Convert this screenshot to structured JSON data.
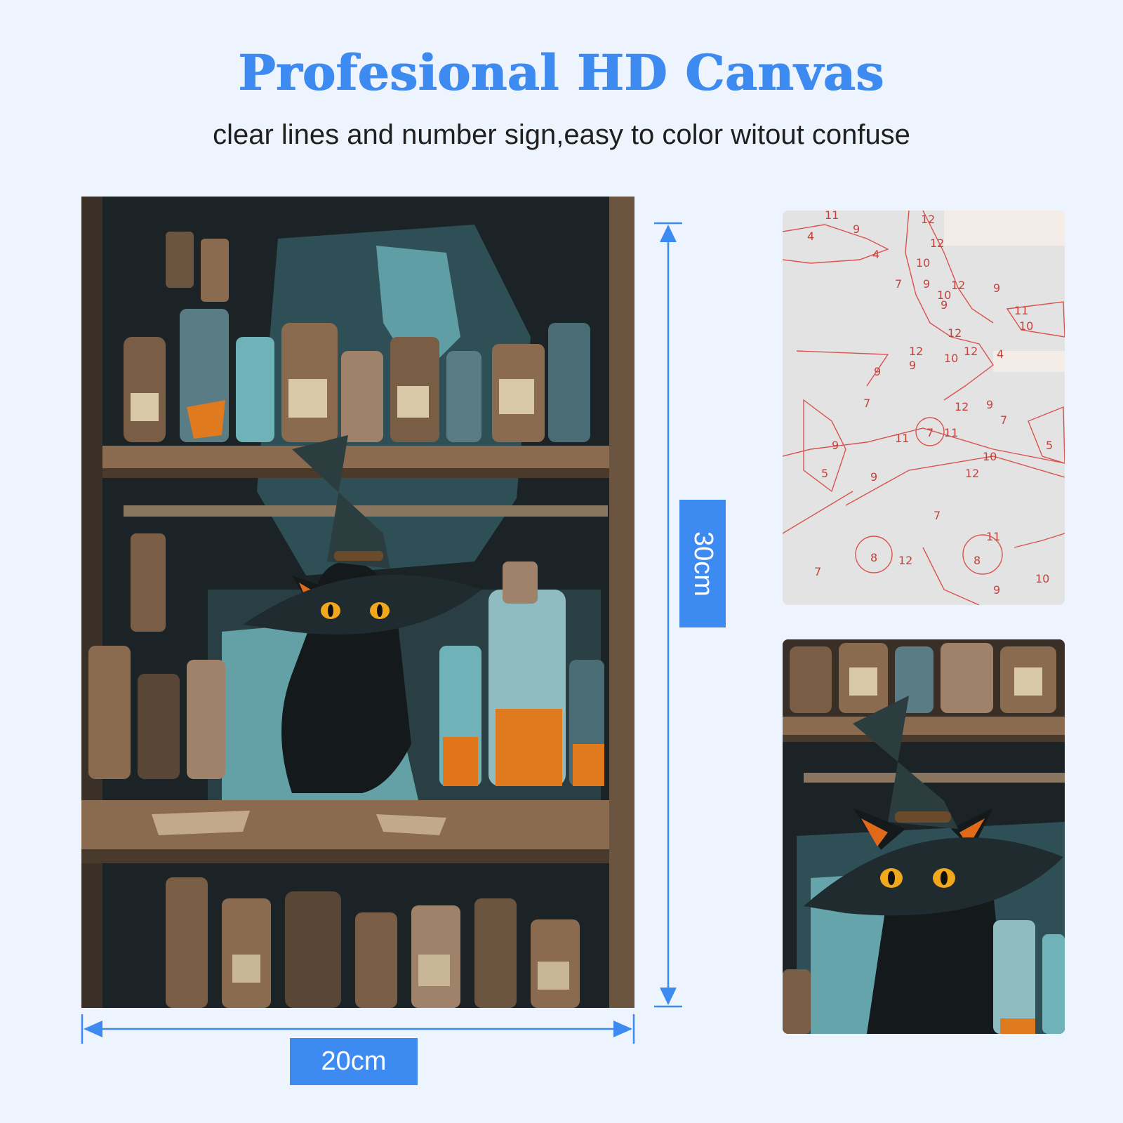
{
  "header": {
    "title": "Profesional HD Canvas",
    "subtitle": "clear lines and number sign,easy to color witout confuse"
  },
  "dimensions": {
    "width_label": "20cm",
    "height_label": "30cm"
  },
  "sketch": {
    "numbers": [
      "11",
      "9",
      "4",
      "12",
      "12",
      "10",
      "4",
      "9",
      "9",
      "12",
      "7",
      "9",
      "10",
      "9",
      "12",
      "11",
      "10",
      "4",
      "12",
      "9",
      "10",
      "12",
      "9",
      "7",
      "12",
      "9",
      "7",
      "11",
      "11",
      "9",
      "5",
      "9",
      "10",
      "5",
      "12",
      "7",
      "7",
      "8",
      "12",
      "8",
      "11",
      "9",
      "10"
    ]
  },
  "colors": {
    "accent": "#3d8bf0",
    "background": "#eef4fd",
    "text": "#1f1f1f",
    "sketch_line": "#d9534f"
  }
}
